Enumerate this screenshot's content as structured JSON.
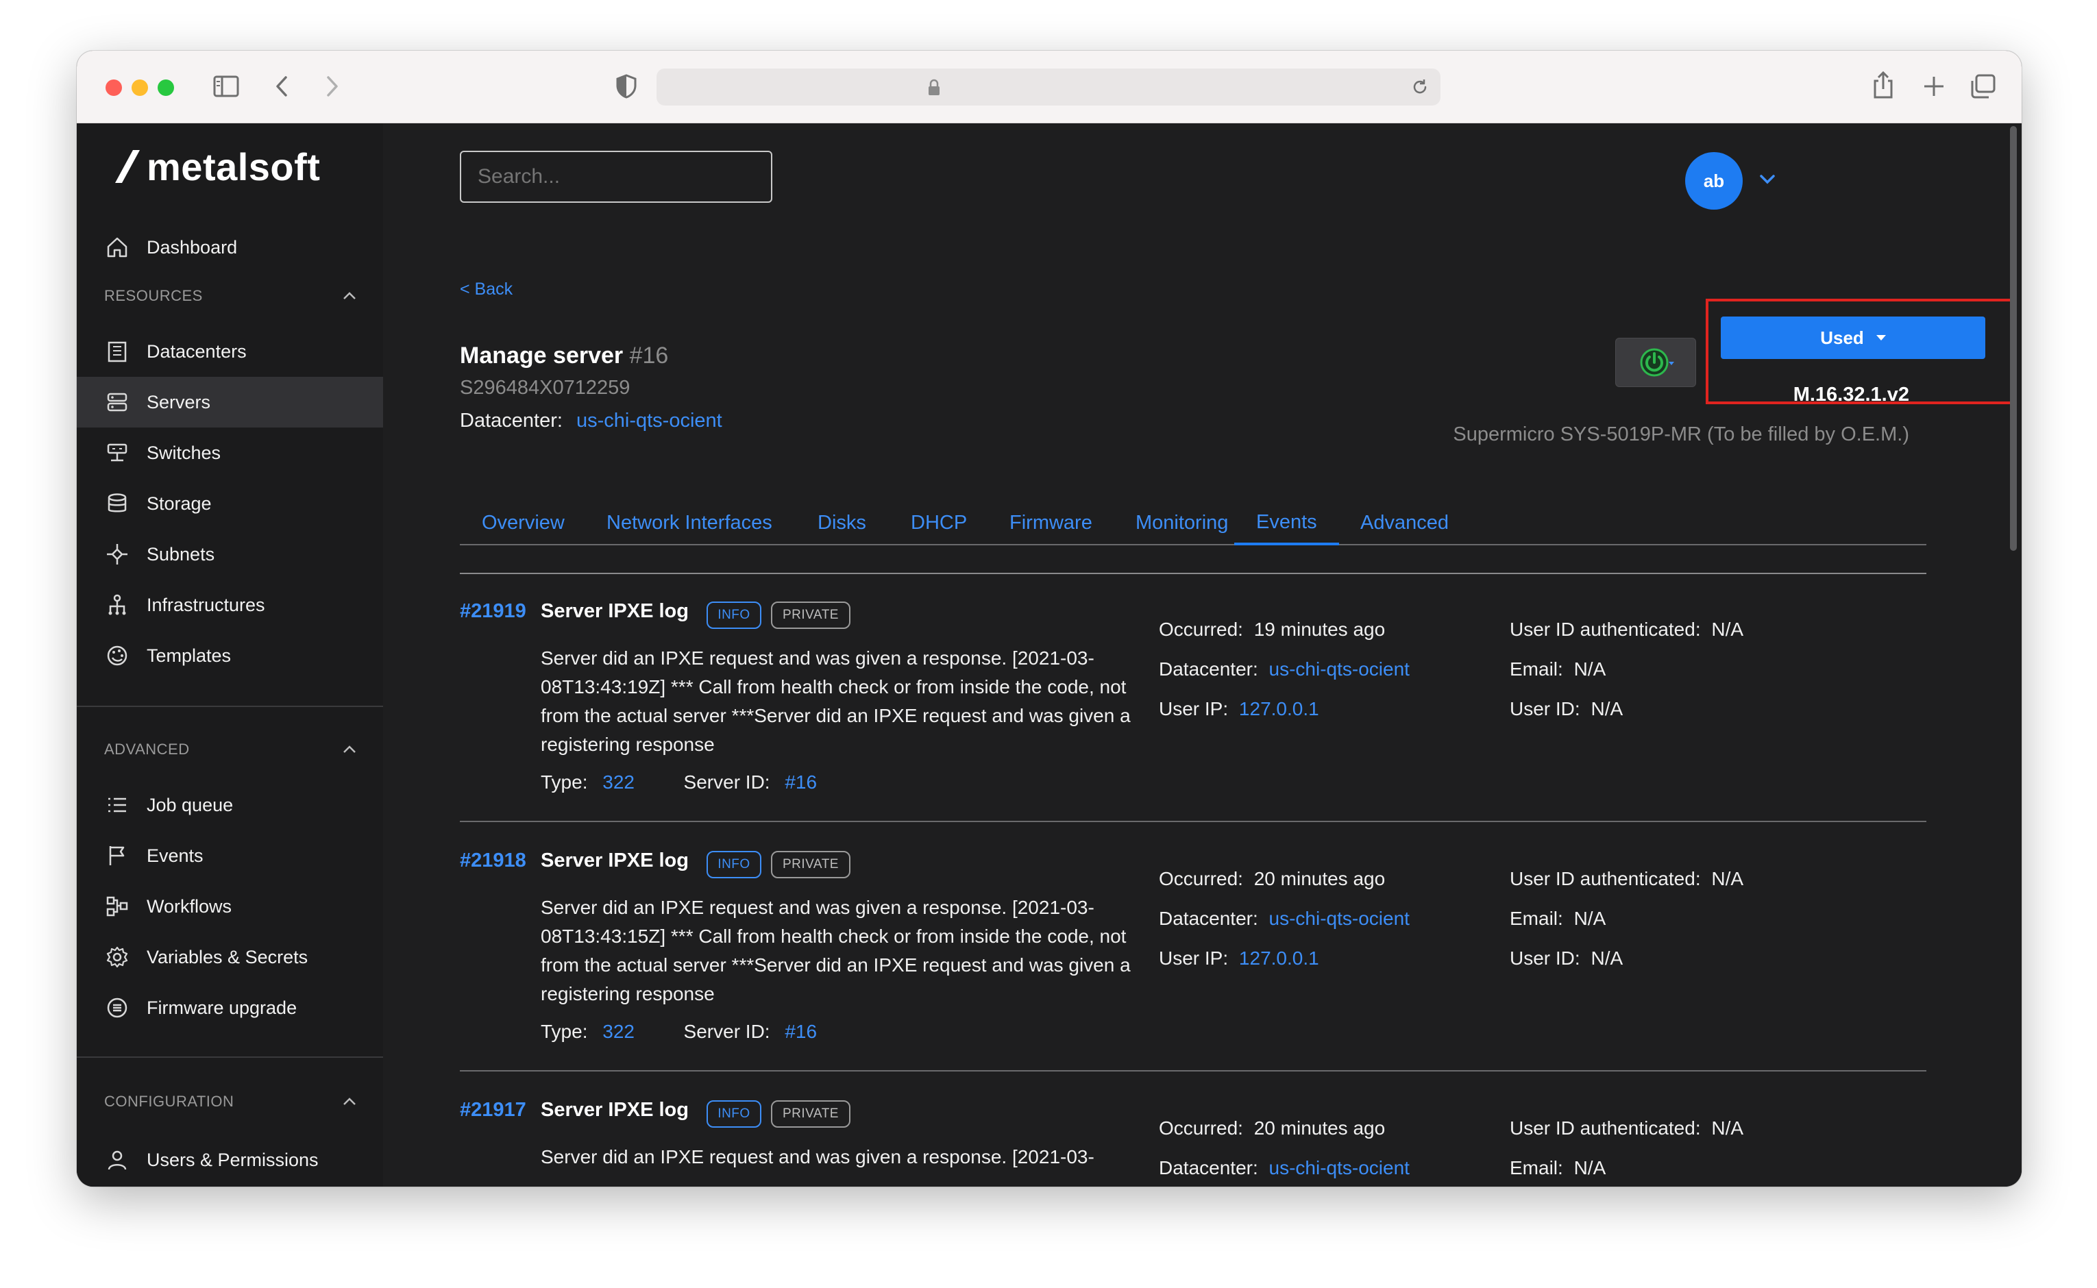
{
  "browser": {
    "url": "",
    "colors": {
      "close": "#fe5f57",
      "minimize": "#febc2e",
      "maximize": "#28c840"
    }
  },
  "brand": {
    "name": "metalsoft"
  },
  "sidebar": {
    "dashboard": "Dashboard",
    "sections": [
      {
        "title": "RESOURCES",
        "items": [
          "Datacenters",
          "Servers",
          "Switches",
          "Storage",
          "Subnets",
          "Infrastructures",
          "Templates"
        ]
      },
      {
        "title": "ADVANCED",
        "items": [
          "Job queue",
          "Events",
          "Workflows",
          "Variables & Secrets",
          "Firmware upgrade"
        ]
      },
      {
        "title": "CONFIGURATION",
        "items": [
          "Users & Permissions"
        ]
      }
    ],
    "active_item": "Servers"
  },
  "header": {
    "search_placeholder": "Search...",
    "avatar_initials": "ab"
  },
  "server": {
    "back_label": "< Back",
    "title": "Manage server",
    "number": "#16",
    "serial": "S296484X0712259",
    "datacenter_label": "Datacenter:",
    "datacenter": "us-chi-qts-ocient",
    "status_button": "Used",
    "firmware_version": "M.16.32.1.v2",
    "model": "Supermicro SYS-5019P-MR (To be filled by O.E.M.)"
  },
  "tabs": [
    "Overview",
    "Network Interfaces",
    "Disks",
    "DHCP",
    "Firmware",
    "Monitoring",
    "Events",
    "Advanced"
  ],
  "active_tab": "Events",
  "labels": {
    "occurred": "Occurred:",
    "datacenter": "Datacenter:",
    "user_ip": "User IP:",
    "user_id_auth": "User ID authenticated:",
    "email": "Email:",
    "user_id": "User ID:",
    "type": "Type:",
    "server_id": "Server ID:",
    "badge_info": "INFO",
    "badge_private": "PRIVATE"
  },
  "events": [
    {
      "id": "#21919",
      "title": "Server IPXE log",
      "description": "Server did an IPXE request and was given a response. [2021-03-08T13:43:19Z] *** Call from health check or from inside the code, not from the actual server ***Server did an IPXE request and was given a registering response",
      "type": "322",
      "server_id": "#16",
      "occurred": "19 minutes ago",
      "datacenter": "us-chi-qts-ocient",
      "user_ip": "127.0.0.1",
      "user_id_auth": "N/A",
      "email": "N/A",
      "user_id": "N/A"
    },
    {
      "id": "#21918",
      "title": "Server IPXE log",
      "description": "Server did an IPXE request and was given a response. [2021-03-08T13:43:15Z] *** Call from health check or from inside the code, not from the actual server ***Server did an IPXE request and was given a registering response",
      "type": "322",
      "server_id": "#16",
      "occurred": "20 minutes ago",
      "datacenter": "us-chi-qts-ocient",
      "user_ip": "127.0.0.1",
      "user_id_auth": "N/A",
      "email": "N/A",
      "user_id": "N/A"
    },
    {
      "id": "#21917",
      "title": "Server IPXE log",
      "description": "Server did an IPXE request and was given a response. [2021-03-",
      "type": "",
      "server_id": "",
      "occurred": "20 minutes ago",
      "datacenter": "us-chi-qts-ocient",
      "user_ip": "",
      "user_id_auth": "N/A",
      "email": "N/A",
      "user_id": ""
    }
  ],
  "colors": {
    "accent": "#1e7cf2",
    "link": "#3d8ef7",
    "highlight": "#e0241f",
    "power": "#2db84d"
  }
}
